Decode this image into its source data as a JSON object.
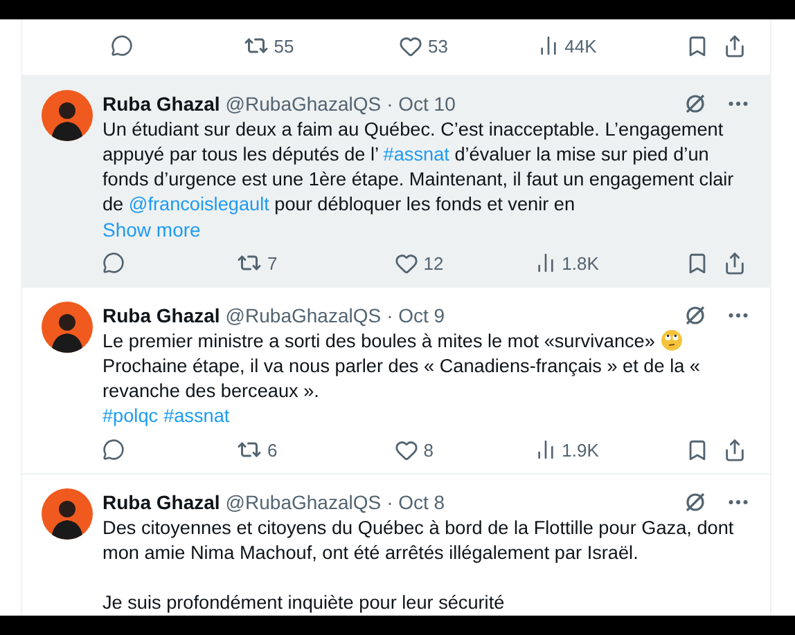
{
  "tweets": [
    {
      "highlighted": false,
      "actions": {
        "retweets": "55",
        "likes": "53",
        "views": "44K"
      }
    },
    {
      "highlighted": true,
      "author": {
        "name": "Ruba Ghazal",
        "handle": "@RubaGhazalQS"
      },
      "date": "· Oct 10",
      "paragraphs": [
        {
          "segments": [
            {
              "kind": "text",
              "text": "Un étudiant sur deux a faim au Québec. C’est inacceptable. L’engagement appuyé par tous les députés de l’ "
            },
            {
              "kind": "hashtag",
              "text": "#assnat"
            },
            {
              "kind": "text",
              "text": " d’évaluer la mise sur pied d’un fonds d’urgence est une 1ère étape. Maintenant, il faut un engagement clair de "
            },
            {
              "kind": "mention",
              "text": "@francoislegault"
            },
            {
              "kind": "text",
              "text": " pour débloquer les fonds et venir en"
            }
          ]
        }
      ],
      "show_more": "Show more",
      "actions": {
        "retweets": "7",
        "likes": "12",
        "views": "1.8K"
      }
    },
    {
      "highlighted": false,
      "author": {
        "name": "Ruba Ghazal",
        "handle": "@RubaGhazalQS"
      },
      "date": "· Oct 9",
      "paragraphs": [
        {
          "segments": [
            {
              "kind": "text",
              "text": "Le premier ministre a sorti des boules à mites le mot «survivance» "
            },
            {
              "kind": "emoji"
            },
            {
              "kind": "text",
              "text": " Prochaine étape, il va nous parler des « Canadiens-français » et de la « revanche des berceaux »."
            }
          ]
        }
      ],
      "hashtags": [
        "#polqc",
        "#assnat"
      ],
      "actions": {
        "retweets": "6",
        "likes": "8",
        "views": "1.9K"
      }
    },
    {
      "highlighted": false,
      "author": {
        "name": "Ruba Ghazal",
        "handle": "@RubaGhazalQS"
      },
      "date": "· Oct 8",
      "paragraphs": [
        {
          "segments": [
            {
              "kind": "text",
              "text": "Des citoyennes et citoyens du Québec à bord de la Flottille pour Gaza, dont mon amie Nima Machouf, ont été arrêtés illégalement par Israël."
            }
          ]
        },
        {
          "blank_before": true,
          "segments": [
            {
              "kind": "text",
              "text": "Je suis profondément inquiète pour leur sécurité"
            }
          ]
        }
      ]
    }
  ]
}
